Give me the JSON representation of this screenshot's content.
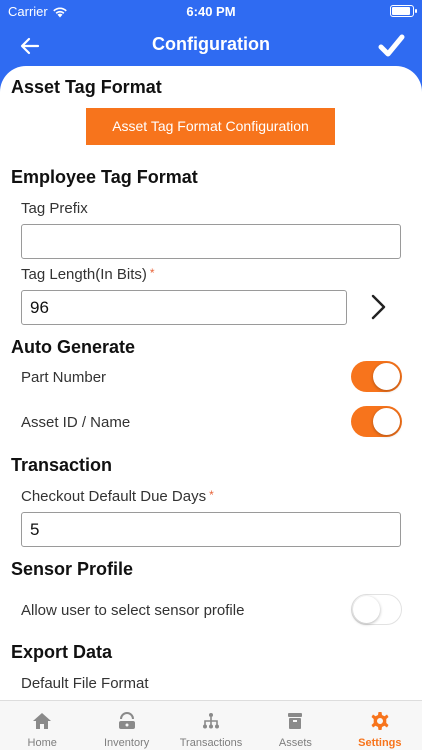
{
  "status": {
    "carrier": "Carrier",
    "time": "6:40 PM"
  },
  "nav": {
    "title": "Configuration"
  },
  "asset_tag": {
    "title": "Asset Tag Format",
    "button_label": "Asset Tag Format Configuration"
  },
  "employee_tag": {
    "title": "Employee Tag Format",
    "prefix_label": "Tag Prefix",
    "prefix_value": "",
    "length_label": "Tag Length(In Bits)",
    "length_required": "*",
    "length_value": "96"
  },
  "auto_generate": {
    "title": "Auto Generate",
    "part_number_label": "Part Number",
    "part_number_on": true,
    "asset_id_label": "Asset ID / Name",
    "asset_id_on": true
  },
  "transaction": {
    "title": "Transaction",
    "due_days_label": "Checkout Default Due Days",
    "due_days_required": "*",
    "due_days_value": "5"
  },
  "sensor_profile": {
    "title": "Sensor Profile",
    "allow_label": "Allow user to select sensor profile",
    "allow_on": false
  },
  "export_data": {
    "title": "Export Data",
    "file_format_label": "Default File Format"
  },
  "tabs": [
    {
      "label": "Home",
      "icon": "home-icon"
    },
    {
      "label": "Inventory",
      "icon": "inventory-icon"
    },
    {
      "label": "Transactions",
      "icon": "transactions-icon"
    },
    {
      "label": "Assets",
      "icon": "assets-icon"
    },
    {
      "label": "Settings",
      "icon": "settings-icon",
      "active": true
    }
  ],
  "colors": {
    "primary": "#2f6bf2",
    "accent": "#f7741c"
  }
}
